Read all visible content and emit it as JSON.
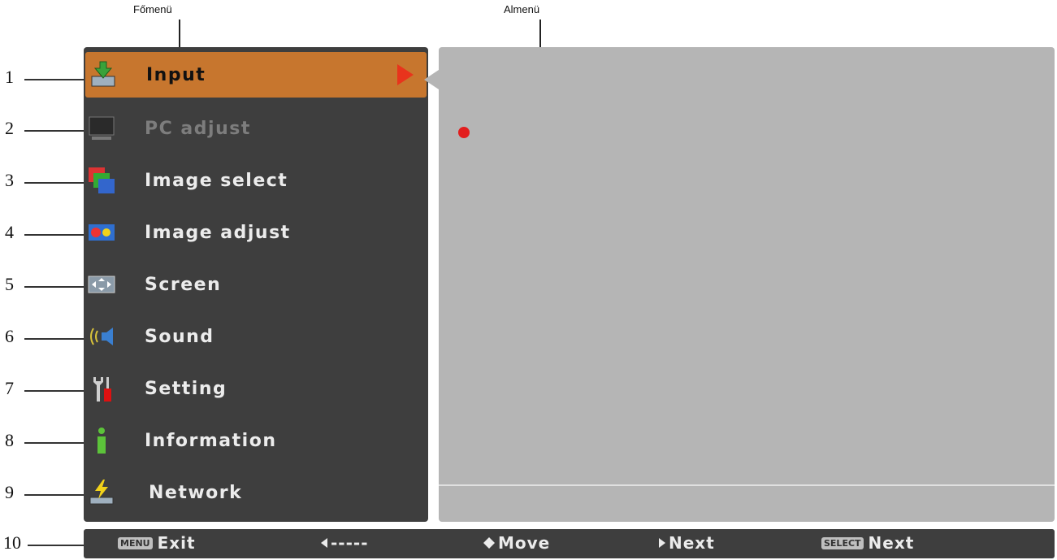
{
  "callouts": {
    "main_menu": "Főmenü",
    "sub_menu": "Almenü"
  },
  "numbers": [
    "1",
    "2",
    "3",
    "4",
    "5",
    "6",
    "7",
    "8",
    "9",
    "10"
  ],
  "menu": {
    "items": [
      {
        "label": "Input",
        "icon": "input-icon",
        "selected": true,
        "disabled": false
      },
      {
        "label": "PC adjust",
        "icon": "monitor-icon",
        "selected": false,
        "disabled": true
      },
      {
        "label": "Image select",
        "icon": "image-select-icon",
        "selected": false,
        "disabled": false
      },
      {
        "label": "Image adjust",
        "icon": "image-adjust-icon",
        "selected": false,
        "disabled": false
      },
      {
        "label": "Screen",
        "icon": "screen-icon",
        "selected": false,
        "disabled": false
      },
      {
        "label": "Sound",
        "icon": "speaker-icon",
        "selected": false,
        "disabled": false
      },
      {
        "label": "Setting",
        "icon": "wrench-screwdriver-icon",
        "selected": false,
        "disabled": false
      },
      {
        "label": "Information",
        "icon": "info-icon",
        "selected": false,
        "disabled": false
      },
      {
        "label": "Network",
        "icon": "network-icon",
        "selected": false,
        "disabled": false
      }
    ]
  },
  "guide": {
    "menu_badge": "MENU",
    "exit": "Exit",
    "back": "-----",
    "move": "Move",
    "next": "Next",
    "select_badge": "SELECT",
    "select_next": "Next"
  },
  "colors": {
    "menu_bg": "#3e3e3e",
    "selected": "#c7762e",
    "submenu_bg": "#b5b5b5",
    "accent_red": "#e8341c"
  }
}
